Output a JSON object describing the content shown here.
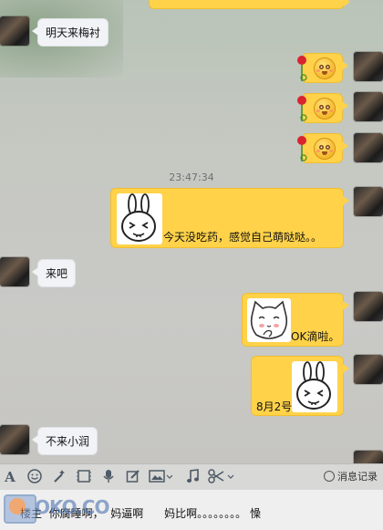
{
  "conversation": {
    "timestamp": "23:47:34",
    "messages": [
      {
        "side": "left",
        "type": "text",
        "text": "明天来梅衬"
      },
      {
        "side": "right",
        "type": "emoji",
        "emoji": "flushed-face-with-rose"
      },
      {
        "side": "right",
        "type": "emoji",
        "emoji": "flushed-face-with-rose"
      },
      {
        "side": "right",
        "type": "emoji",
        "emoji": "flushed-face-with-rose"
      },
      {
        "side": "right",
        "type": "sticker",
        "sticker": "rabbit-sticker",
        "text": "今天没吃药，感觉自己萌哒哒。。"
      },
      {
        "side": "left",
        "type": "text",
        "text": "来吧"
      },
      {
        "side": "right",
        "type": "sticker",
        "sticker": "cat-sticker",
        "text": "OK滴啦。"
      },
      {
        "side": "right",
        "type": "sticker",
        "sticker": "rabbit-sticker",
        "text": "8月2号"
      },
      {
        "side": "left",
        "type": "text",
        "text": "不来小润"
      }
    ]
  },
  "toolbar": {
    "history_label": "消息记录",
    "icons": [
      "font-icon",
      "emoji-icon",
      "magic-icon",
      "video-icon",
      "mic-icon",
      "edit-icon",
      "image-icon",
      "music-icon",
      "scissors-icon"
    ]
  },
  "input": {
    "value": "楼主  你腐睡啊，  妈逼啊      妈比啊。。。。。。。。 懆"
  },
  "watermark": {
    "text": "OKO.CO"
  },
  "colors": {
    "bubble_right": "#ffd24a",
    "bubble_left": "#f2f3f6",
    "toolbar_icon": "#4e5a66"
  }
}
